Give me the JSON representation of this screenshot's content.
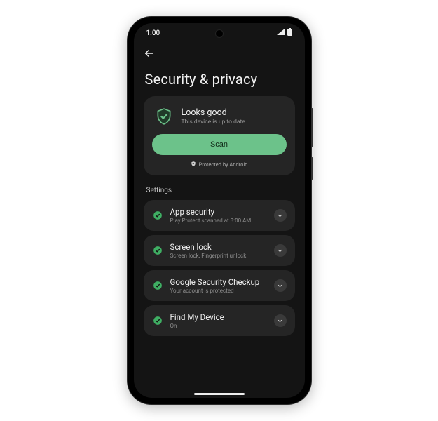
{
  "status_bar": {
    "time": "1:00"
  },
  "page": {
    "title": "Security & privacy"
  },
  "status_card": {
    "title": "Looks good",
    "subtitle": "This device is up to date",
    "scan_label": "Scan",
    "protected_label": "Protected by Android"
  },
  "section": {
    "label": "Settings"
  },
  "items": [
    {
      "title": "App security",
      "subtitle": "Play Protect scanned at 8:00 AM"
    },
    {
      "title": "Screen lock",
      "subtitle": "Screen lock, Fingerprint unlock"
    },
    {
      "title": "Google Security Checkup",
      "subtitle": "Your account is protected"
    },
    {
      "title": "Find My Device",
      "subtitle": "On"
    }
  ],
  "colors": {
    "accent": "#6cc28a"
  }
}
